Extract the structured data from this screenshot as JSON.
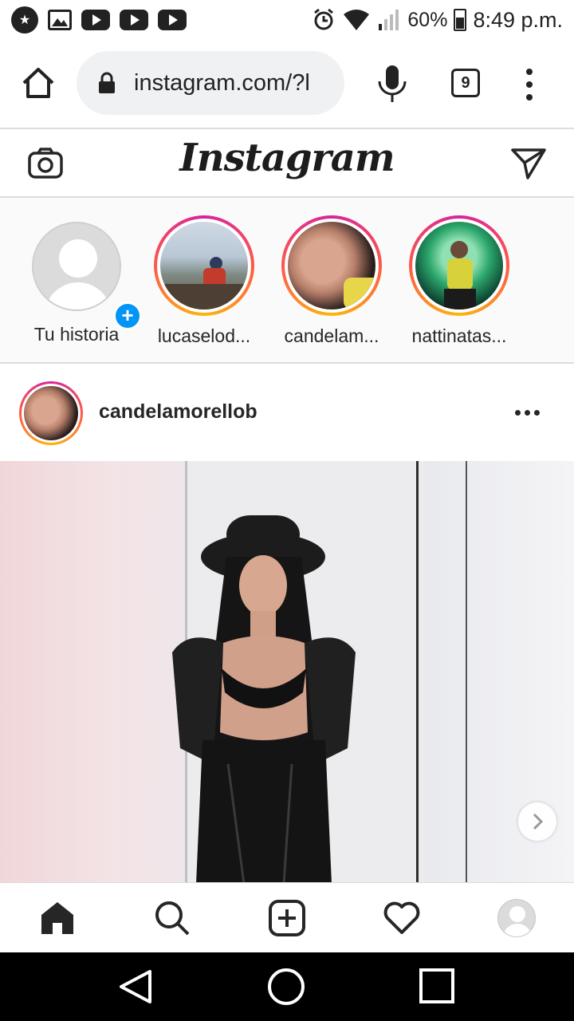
{
  "status_bar": {
    "battery": "60%",
    "time": "8:49 p.m."
  },
  "browser": {
    "url": "instagram.com/?l",
    "tab_count": "9"
  },
  "header": {
    "logo": "Instagram"
  },
  "stories": [
    {
      "label": "Tu historia"
    },
    {
      "label": "lucaselod..."
    },
    {
      "label": "candelam..."
    },
    {
      "label": "nattinatas..."
    }
  ],
  "post": {
    "username": "candelamorellob"
  },
  "icons": {
    "status": [
      "star-icon",
      "gallery-icon",
      "youtube-icon",
      "youtube-icon",
      "youtube-icon",
      "alarm-icon",
      "wifi-icon",
      "signal-icon",
      "battery-icon"
    ],
    "browser": [
      "home-icon",
      "lock-icon",
      "mic-icon",
      "tabs-icon",
      "menu-icon"
    ],
    "instagram": [
      "camera-icon",
      "direct-send-icon",
      "more-icon",
      "next-arrow-icon"
    ],
    "nav": [
      "home-icon",
      "search-icon",
      "new-post-icon",
      "heart-icon",
      "profile-icon"
    ],
    "android": [
      "back-icon",
      "home-circle-icon",
      "recents-icon"
    ]
  },
  "colors": {
    "story_ring": "#d6249f",
    "story_ring_secondary": "#fdb70a",
    "add_story": "#0095f6"
  }
}
